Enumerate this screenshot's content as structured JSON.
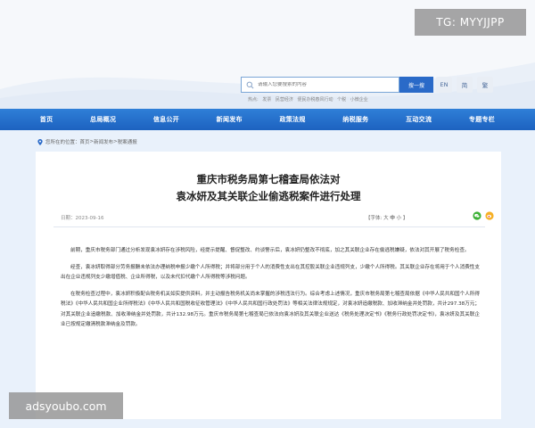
{
  "watermarks": {
    "top_right": "TG: MYYJJPP",
    "bottom_left": "adsyoubo.com"
  },
  "search": {
    "placeholder": "请输入您要搜索的内容",
    "button_label": "搜一搜",
    "hot_label": "热点:",
    "hot_terms": [
      "发票",
      "民营经济",
      "便民办税春风行动",
      "个税",
      "小微企业"
    ]
  },
  "languages": [
    "EN",
    "简",
    "繁"
  ],
  "nav": [
    "首页",
    "总局概况",
    "信息公开",
    "新闻发布",
    "政策法规",
    "纳税服务",
    "互动交流",
    "专题专栏"
  ],
  "breadcrumb": {
    "prefix": "您所在的位置：",
    "items": [
      "首页",
      "新闻发布",
      "税案通报"
    ],
    "separator": ">"
  },
  "article": {
    "title_line1": "重庆市税务局第七稽查局依法对",
    "title_line2": "袁冰妍及其关联企业偷逃税案件进行处理",
    "date": "日期：2023-09-16",
    "font_size": {
      "prefix": "【字体:",
      "large": "大",
      "medium": "中",
      "small": "小",
      "suffix": "】"
    },
    "paragraphs": [
      "前期，重庆市税务部门通过分析发现袁冰妍存在涉税风险，经提示提醒、督促整改、约谈警示后，袁冰妍仍整改不彻底，加之其关联企业存在偷逃税嫌疑，依法对其开展了税务检查。",
      "经查，袁冰妍取得部分劳务报酬未依法办理纳税申报少缴个人所得税；并将部分用于个人的消费性支出在其控股关联企业违规列支，少缴个人所得税。其关联企业存在将用于个人消费性支出在企业违规列支少缴增值税、企业所得税，以及未代扣代缴个人所得税等涉税问题。",
      "在税务检查过程中，袁冰妍积极配合税务机关如实提供资料，并主动报告税务机关尚未掌握的涉税违法行为。综合考虑上述情况，重庆市税务局第七稽查局依据《中华人民共和国个人所得税法》《中华人民共和国企业所得税法》《中华人民共和国税收征收管理法》《中华人民共和国行政处罚法》等相关法律法规规定，对袁冰妍追缴税款、加收滞纳金并处罚款，共计297.38万元；对其关联企业追缴税款、加收滞纳金并处罚款，共计132.98万元。重庆市税务局第七稽查局已依法向袁冰妍及其关联企业送达《税务处理决定书》《税务行政处罚决定书》，袁冰妍及其关联企业已按规定缴清税款滞纳金及罚款。"
    ]
  },
  "colors": {
    "nav_blue": "#1d62c0",
    "accent_blue": "#2a6ac8",
    "page_bg": "#e9f1fb"
  }
}
